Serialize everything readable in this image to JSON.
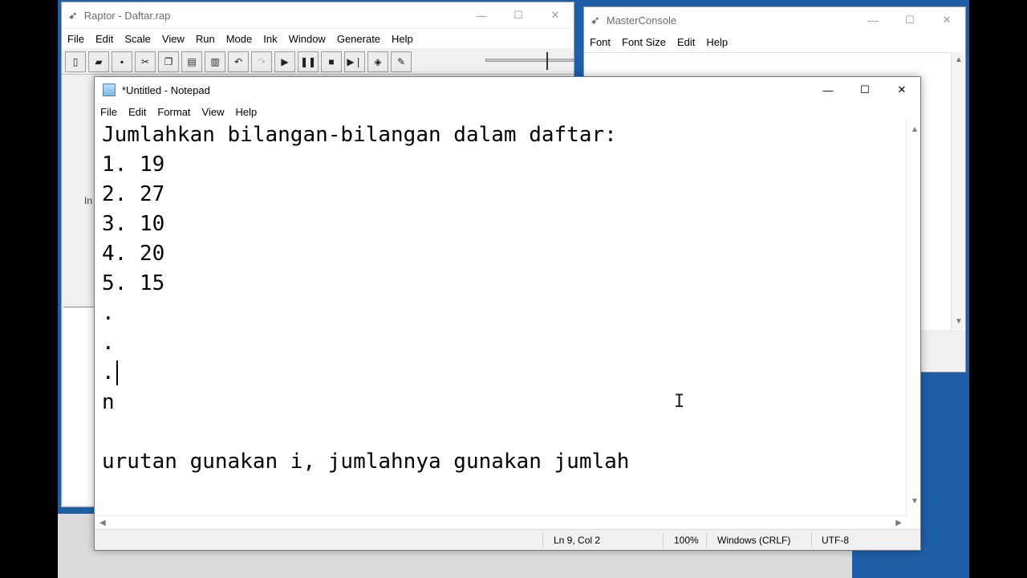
{
  "raptor": {
    "title": "Raptor - Daftar.rap",
    "menu": [
      "File",
      "Edit",
      "Scale",
      "View",
      "Run",
      "Mode",
      "Ink",
      "Window",
      "Generate",
      "Help"
    ],
    "toolbar_icons": [
      "new-icon",
      "open-icon",
      "save-icon",
      "cut-icon",
      "copy-icon",
      "paste-icon",
      "print-icon",
      "undo-icon",
      "redo-icon",
      "play-icon",
      "pause-icon",
      "stop-icon",
      "step-icon",
      "test-icon",
      "pen-icon"
    ],
    "fragment": "In"
  },
  "console": {
    "title": "MasterConsole",
    "menu": [
      "Font",
      "Font Size",
      "Edit",
      "Help"
    ]
  },
  "notepad": {
    "title": "*Untitled - Notepad",
    "menu": [
      "File",
      "Edit",
      "Format",
      "View",
      "Help"
    ],
    "lines": [
      "Jumlahkan bilangan-bilangan dalam daftar:",
      "1. 19",
      "2. 27",
      "3. 10",
      "4. 20",
      "5. 15",
      ".",
      ".",
      ".",
      "n",
      "",
      "urutan gunakan i, jumlahnya gunakan jumlah"
    ],
    "status": {
      "position": "Ln 9, Col 2",
      "zoom": "100%",
      "line_ending": "Windows (CRLF)",
      "encoding": "UTF-8"
    }
  }
}
